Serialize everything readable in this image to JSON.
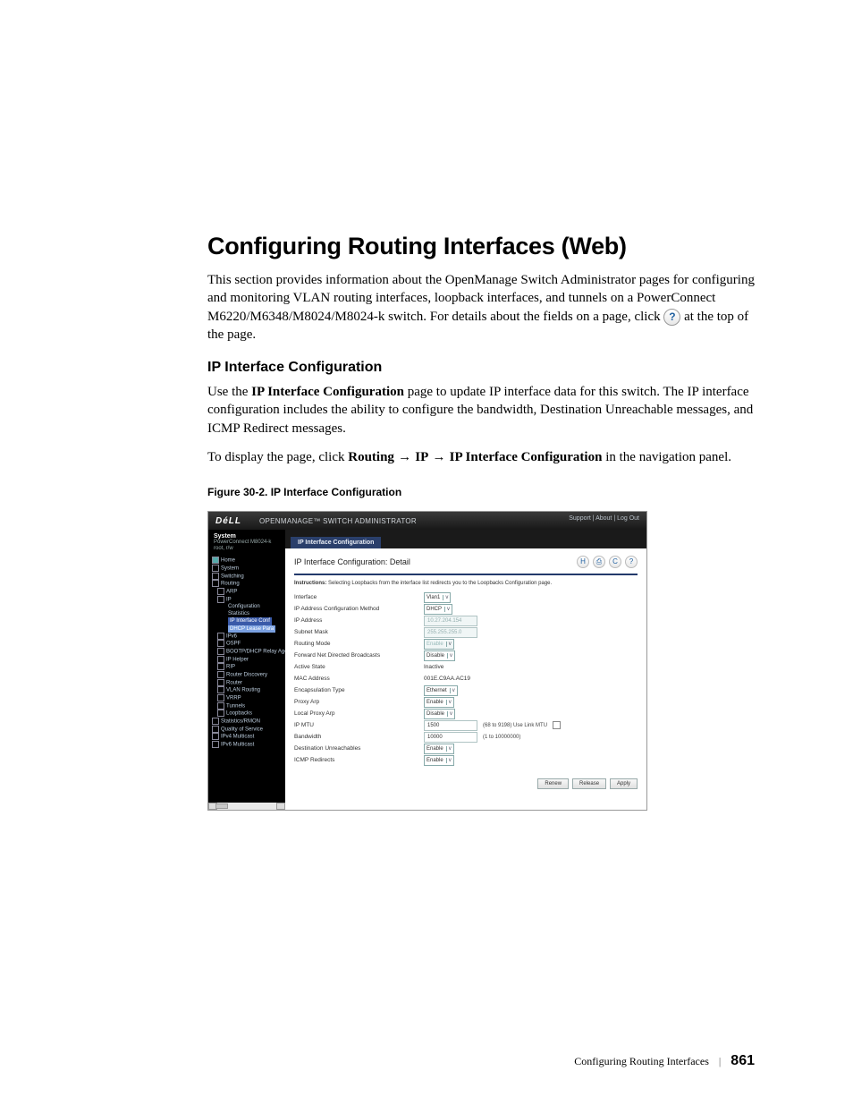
{
  "headings": {
    "main": "Configuring Routing Interfaces (Web)",
    "sub": "IP Interface Configuration"
  },
  "paragraphs": {
    "intro_a": "This section provides information about the OpenManage Switch Administrator pages for configuring and monitoring VLAN routing interfaces, loopback interfaces, and tunnels on a PowerConnect M6220/M6348/M8024/M8024-k switch. For details about the fields on a page, click ",
    "intro_b": " at the top of the page.",
    "help_glyph": "?",
    "use_a": "Use the ",
    "use_bold": "IP Interface Configuration",
    "use_b": " page to update IP interface data for this switch. The IP interface configuration includes the ability to configure the bandwidth, Destination Unreachable messages, and ICMP Redirect messages.",
    "nav_a": "To display the page, click ",
    "nav_b1": "Routing",
    "nav_b2": "IP",
    "nav_b3": "IP Interface Configuration",
    "nav_c": " in the navigation panel.",
    "arrow": " → "
  },
  "caption": "Figure 30-2.    IP Interface Configuration",
  "footer": {
    "title": "Configuring Routing Interfaces",
    "sep": "|",
    "page": "861"
  },
  "screenshot": {
    "logo": "DéLL",
    "product": "OPENMANAGE™ SWITCH ADMINISTRATOR",
    "toplinks": "Support  |  About  |  Log Out",
    "side_head": "System",
    "side_sub1": "PowerConnect M8024-k",
    "side_sub2": "root, r/w",
    "tree": {
      "home": "Home",
      "system": "System",
      "switching": "Switching",
      "routing": "Routing",
      "arp": "ARP",
      "ip": "IP",
      "configuration": "Configuration",
      "statistics": "Statistics",
      "ipif": "IP Interface Conf",
      "dhcp": "DHCP Lease Para",
      "ipv6": "IPv6",
      "ospf": "OSPF",
      "bootp": "BOOTP/DHCP Relay Age",
      "iphelper": "IP Helper",
      "rip": "RIP",
      "rdisc": "Router Discovery",
      "router": "Router",
      "vlanr": "VLAN Routing",
      "vrrp": "VRRP",
      "tunnels": "Tunnels",
      "loopbacks": "Loopbacks",
      "stats": "Statistics/RMON",
      "qos": "Quality of Service",
      "v4m": "IPv4 Multicast",
      "v6m": "IPv6 Multicast"
    },
    "tab": "IP Interface Configuration",
    "panel_title": "IP Interface Configuration: Detail",
    "toolbar": {
      "save": "H",
      "print": "⎙",
      "refresh": "C",
      "help": "?"
    },
    "instr_b": "Instructions:",
    "instr": " Selecting Loopbacks from the interface list redirects you to the Loopbacks Configuration page.",
    "rows": [
      {
        "lbl": "Interface",
        "type": "select",
        "val": "Vlan1"
      },
      {
        "lbl": "IP Address Configuration Method",
        "type": "select",
        "val": "DHCP"
      },
      {
        "lbl": "IP Address",
        "type": "textdis",
        "val": "10.27.204.154"
      },
      {
        "lbl": "Subnet Mask",
        "type": "textdis",
        "val": "255.255.255.0"
      },
      {
        "lbl": "Routing Mode",
        "type": "selectdis",
        "val": "Enable"
      },
      {
        "lbl": "Forward Net Directed Broadcasts",
        "type": "select",
        "val": "Disable"
      },
      {
        "lbl": "Active State",
        "type": "static",
        "val": "Inactive"
      },
      {
        "lbl": "MAC Address",
        "type": "static",
        "val": "001E.C9AA.AC19"
      },
      {
        "lbl": "Encapsulation Type",
        "type": "select",
        "val": "Ethernet"
      },
      {
        "lbl": "Proxy Arp",
        "type": "select",
        "val": "Enable"
      },
      {
        "lbl": "Local Proxy Arp",
        "type": "select",
        "val": "Disable"
      },
      {
        "lbl": "IP MTU",
        "type": "text",
        "val": "1500",
        "extra": "(68 to 9198)   Use Link MTU",
        "chk": true
      },
      {
        "lbl": "Bandwidth",
        "type": "text",
        "val": "10000",
        "extra": "(1 to 10000000)"
      },
      {
        "lbl": "Destination Unreachables",
        "type": "select",
        "val": "Enable"
      },
      {
        "lbl": "ICMP Redirects",
        "type": "select",
        "val": "Enable"
      }
    ],
    "btns": {
      "renew": "Renew",
      "release": "Release",
      "apply": "Apply"
    }
  }
}
